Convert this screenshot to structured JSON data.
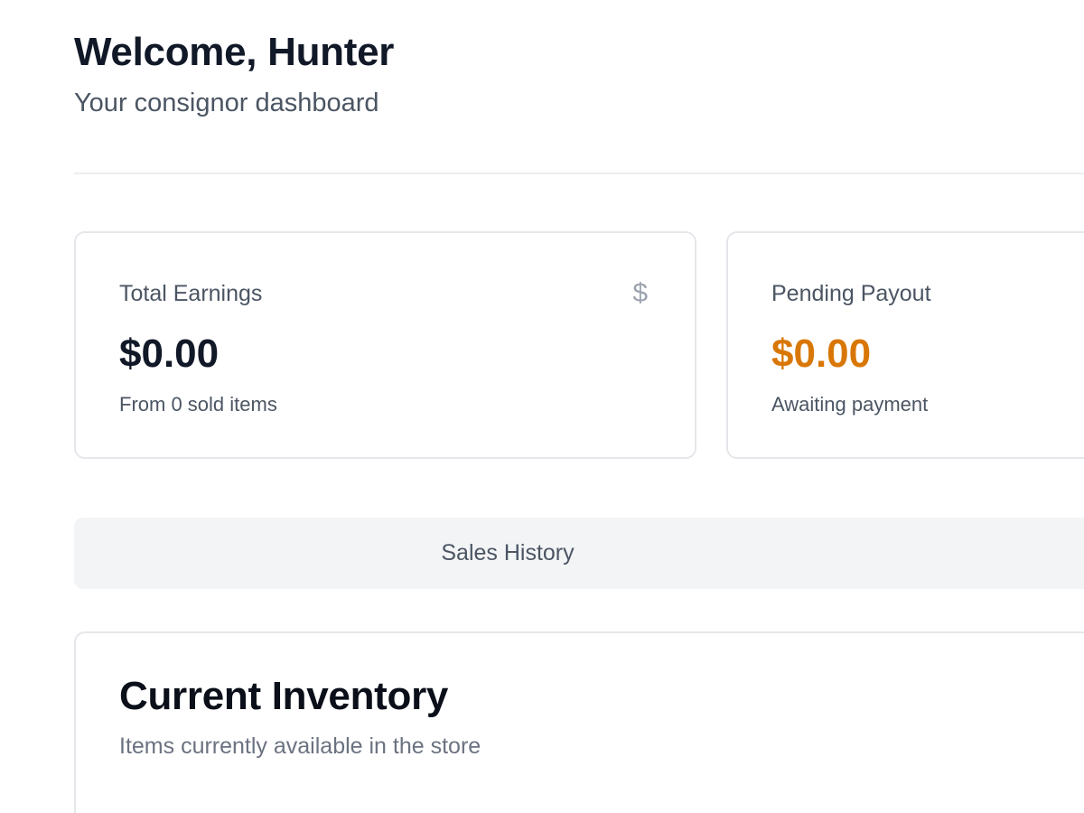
{
  "header": {
    "title": "Welcome, Hunter",
    "subtitle": "Your consignor dashboard"
  },
  "stats": [
    {
      "label": "Total Earnings",
      "icon": "dollar-icon",
      "icon_glyph": "$",
      "value": "$0.00",
      "caption": "From 0 sold items"
    },
    {
      "label": "Pending Payout",
      "value": "$0.00",
      "caption": "Awaiting payment",
      "value_color": "#d97706"
    }
  ],
  "tabs": [
    {
      "label": "Sales History"
    }
  ],
  "inventory": {
    "title": "Current Inventory",
    "subtitle": "Items currently available in the store"
  }
}
